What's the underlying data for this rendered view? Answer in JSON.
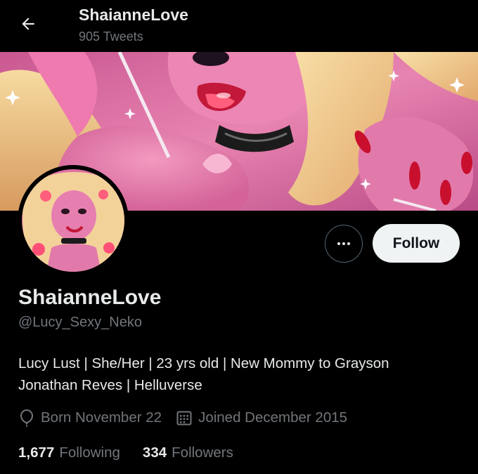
{
  "header": {
    "back_icon": "arrow-left-icon",
    "display_name": "ShaianneLove",
    "tweet_count": "905 Tweets"
  },
  "banner": {
    "description_icon": "artwork-banner",
    "colors": {
      "skin": "#e0739f",
      "hair": "#f1cc86",
      "lips": "#d91d3a",
      "collar": "#1b1b1b",
      "nails": "#c8102e"
    }
  },
  "avatar": {
    "icon": "profile-avatar-artwork"
  },
  "actions": {
    "more_icon": "more-dots-icon",
    "follow_label": "Follow"
  },
  "profile": {
    "name": "ShaianneLove",
    "handle": "@Lucy_Sexy_Neko",
    "bio_line1": "Lucy Lust | She/Her | 23 yrs old | New Mommy to Grayson",
    "bio_line2": "Jonathan Reves | Helluverse",
    "birthday_icon": "balloon-icon",
    "birthday": "Born November 22",
    "joined_icon": "calendar-icon",
    "joined": "Joined December 2015"
  },
  "stats": {
    "following_count": "1,677",
    "following_label": "Following",
    "followers_count": "334",
    "followers_label": "Followers"
  },
  "colors": {
    "background": "#000000",
    "primary_text": "#e7e9ea",
    "secondary_text": "#71767b",
    "follow_button_bg": "#eff3f4",
    "follow_button_text": "#0f1419",
    "outline": "#536471"
  }
}
